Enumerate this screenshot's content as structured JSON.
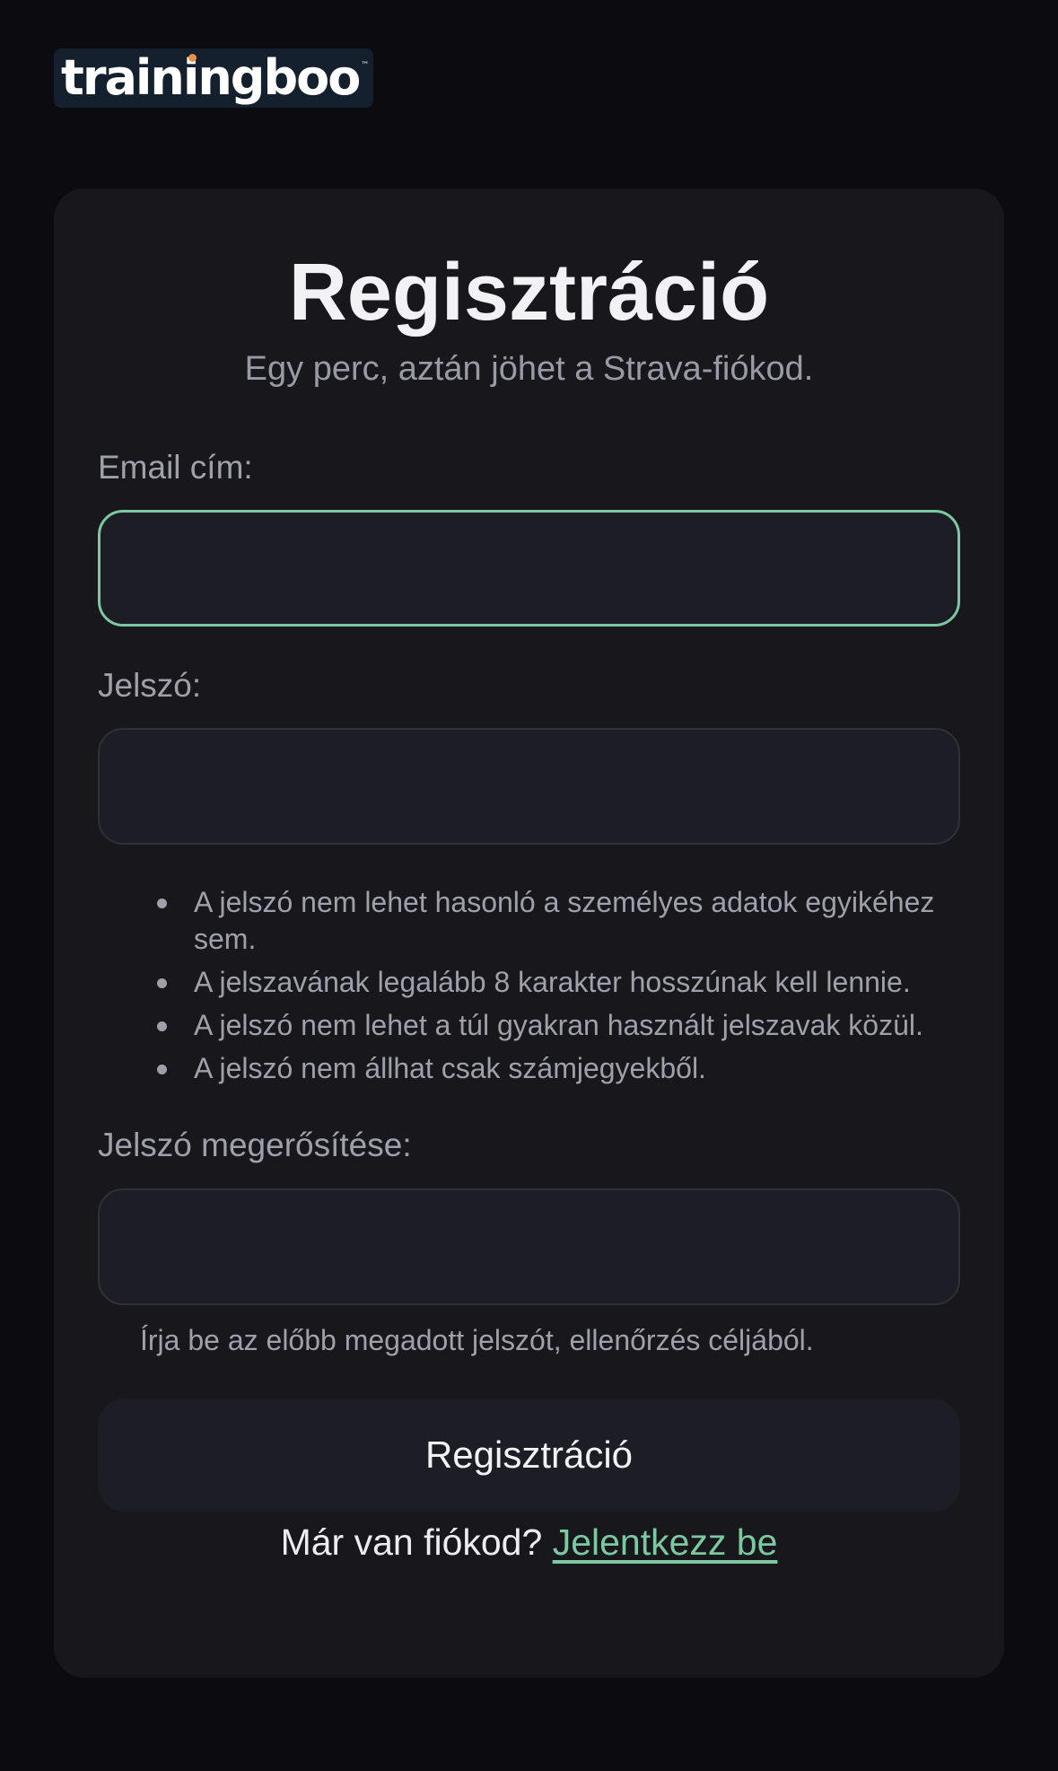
{
  "brand": {
    "logo_text": "trainingboo",
    "trademark": "™",
    "accent_color": "#e8904a"
  },
  "colors": {
    "background": "#0b0b10",
    "card": "#17171c",
    "focus_border": "#7cc8a0",
    "link": "#7cc8a0"
  },
  "form": {
    "title": "Regisztráció",
    "subtitle": "Egy perc, aztán jöhet a Strava-fiókod.",
    "email_label": "Email cím:",
    "email_value": "",
    "password_label": "Jelszó:",
    "password_value": "",
    "password_rules": [
      "A jelszó nem lehet hasonló a személyes adatok egyikéhez sem.",
      "A jelszavának legalább 8 karakter hosszúnak kell lennie.",
      "A jelszó nem lehet a túl gyakran használt jelszavak közül.",
      "A jelszó nem állhat csak számjegyekből."
    ],
    "confirm_label": "Jelszó megerősítése:",
    "confirm_value": "",
    "confirm_help": "Írja be az előbb megadott jelszót, ellenőrzés céljából.",
    "submit_label": "Regisztráció",
    "login_prompt": "Már van fiókod?",
    "login_link": "Jelentkezz be"
  }
}
